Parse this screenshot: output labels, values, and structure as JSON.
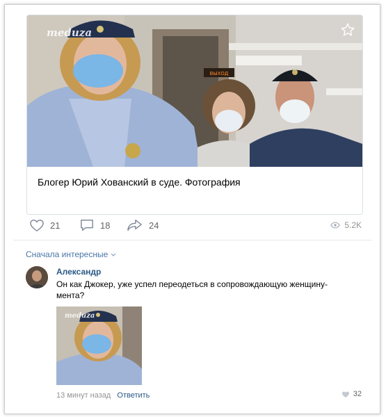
{
  "post": {
    "watermark": "meduza",
    "exit_sign": "ВЫХОД",
    "caption": "Блогер Юрий Хованский в суде. Фотография"
  },
  "actions": {
    "likes": "21",
    "comments": "18",
    "shares": "24",
    "views": "5.2K"
  },
  "comments": {
    "sort_label": "Сначала интересные",
    "author": "Александр",
    "text": "Он как Джокер, уже успел переодеться в сопровождающую женщину-мента?",
    "photo_watermark": "meduza",
    "time": "13 минут назад",
    "reply_label": "Ответить",
    "likes": "32"
  },
  "colors": {
    "link": "#2a5885",
    "accent": "#4a76a8",
    "muted": "#939393",
    "border": "#dce1e6"
  }
}
